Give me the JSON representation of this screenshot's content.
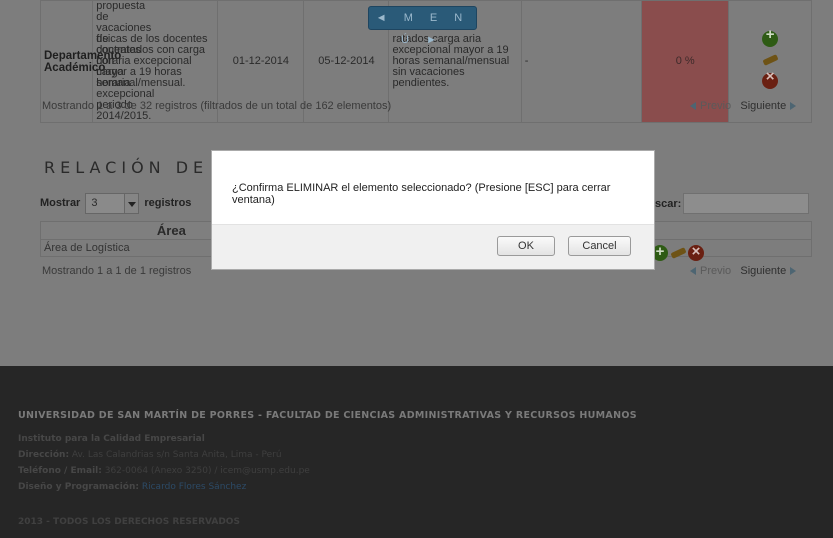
{
  "menu": {
    "label": "◄ M E N Ú ►"
  },
  "table1": {
    "row": {
      "area": "Departamento Académico",
      "col2": "propuesta de vacaciones de docentes con carga horaria excepcional periodo 2014/2015.",
      "col3": "físicas de los docentes contratados con carga horaria excepcional mayor a 19 horas semanal/mensual.",
      "start": "01-12-2014",
      "end": "05-12-2014",
      "col6": "ratados carga aria excepcional mayor a 19 horas semanal/mensual sin vacaciones pendientes.",
      "col7": "-",
      "pct": "0 %"
    },
    "showing": "Mostrando 1 a 3 de 32 registros (filtrados de un total de 162 elementos)",
    "prev": "Previo",
    "next": "Siguiente"
  },
  "section2": {
    "title": "RELACIÓN DE JE",
    "length_label_pre": "Mostrar",
    "length_value": "3",
    "length_label_post": "registros",
    "search_label": "scar:",
    "column_header": "Área",
    "rows": [
      "Área de Logística"
    ],
    "showing": "Mostrando 1 a 1 de 1 registros",
    "prev": "Previo",
    "next": "Siguiente"
  },
  "footer": {
    "title": "UNIVERSIDAD DE SAN MARTÍN DE PORRES - FACULTAD DE CIENCIAS ADMINISTRATIVAS Y RECURSOS HUMANOS",
    "line1": "Instituto para la Calidad Empresarial",
    "line2_label": "Dirección:",
    "line2_value": "Av. Las Calandrias s/n Santa Anita, Lima - Perú",
    "line3_label": "Teléfono / Email:",
    "line3_value": "362-0064 (Anexo 3250) / icem@usmp.edu.pe",
    "line4_label": "Diseño y Programación:",
    "line4_value": "Ricardo Flores Sánchez",
    "copyright": "2013 - TODOS LOS DERECHOS RESERVADOS"
  },
  "modal": {
    "message": "¿Confirma ELIMINAR el elemento seleccionado? (Presione [ESC] para cerrar ventana)",
    "ok": "OK",
    "cancel": "Cancel"
  },
  "icons": [
    "add-icon",
    "edit-icon",
    "delete-icon"
  ]
}
